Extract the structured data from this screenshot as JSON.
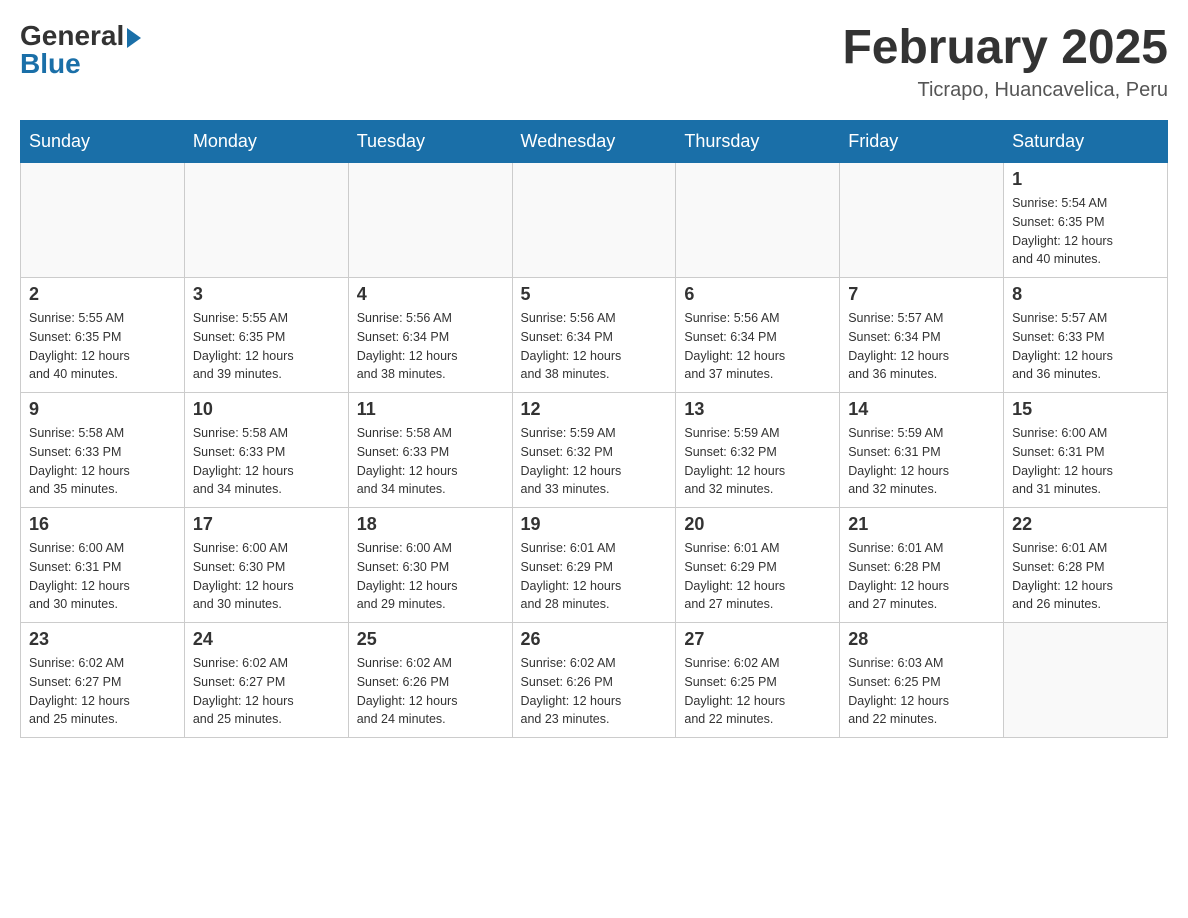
{
  "logo": {
    "general": "General",
    "blue": "Blue"
  },
  "header": {
    "title": "February 2025",
    "subtitle": "Ticrapo, Huancavelica, Peru"
  },
  "weekdays": [
    "Sunday",
    "Monday",
    "Tuesday",
    "Wednesday",
    "Thursday",
    "Friday",
    "Saturday"
  ],
  "weeks": [
    [
      {
        "day": "",
        "info": ""
      },
      {
        "day": "",
        "info": ""
      },
      {
        "day": "",
        "info": ""
      },
      {
        "day": "",
        "info": ""
      },
      {
        "day": "",
        "info": ""
      },
      {
        "day": "",
        "info": ""
      },
      {
        "day": "1",
        "info": "Sunrise: 5:54 AM\nSunset: 6:35 PM\nDaylight: 12 hours\nand 40 minutes."
      }
    ],
    [
      {
        "day": "2",
        "info": "Sunrise: 5:55 AM\nSunset: 6:35 PM\nDaylight: 12 hours\nand 40 minutes."
      },
      {
        "day": "3",
        "info": "Sunrise: 5:55 AM\nSunset: 6:35 PM\nDaylight: 12 hours\nand 39 minutes."
      },
      {
        "day": "4",
        "info": "Sunrise: 5:56 AM\nSunset: 6:34 PM\nDaylight: 12 hours\nand 38 minutes."
      },
      {
        "day": "5",
        "info": "Sunrise: 5:56 AM\nSunset: 6:34 PM\nDaylight: 12 hours\nand 38 minutes."
      },
      {
        "day": "6",
        "info": "Sunrise: 5:56 AM\nSunset: 6:34 PM\nDaylight: 12 hours\nand 37 minutes."
      },
      {
        "day": "7",
        "info": "Sunrise: 5:57 AM\nSunset: 6:34 PM\nDaylight: 12 hours\nand 36 minutes."
      },
      {
        "day": "8",
        "info": "Sunrise: 5:57 AM\nSunset: 6:33 PM\nDaylight: 12 hours\nand 36 minutes."
      }
    ],
    [
      {
        "day": "9",
        "info": "Sunrise: 5:58 AM\nSunset: 6:33 PM\nDaylight: 12 hours\nand 35 minutes."
      },
      {
        "day": "10",
        "info": "Sunrise: 5:58 AM\nSunset: 6:33 PM\nDaylight: 12 hours\nand 34 minutes."
      },
      {
        "day": "11",
        "info": "Sunrise: 5:58 AM\nSunset: 6:33 PM\nDaylight: 12 hours\nand 34 minutes."
      },
      {
        "day": "12",
        "info": "Sunrise: 5:59 AM\nSunset: 6:32 PM\nDaylight: 12 hours\nand 33 minutes."
      },
      {
        "day": "13",
        "info": "Sunrise: 5:59 AM\nSunset: 6:32 PM\nDaylight: 12 hours\nand 32 minutes."
      },
      {
        "day": "14",
        "info": "Sunrise: 5:59 AM\nSunset: 6:31 PM\nDaylight: 12 hours\nand 32 minutes."
      },
      {
        "day": "15",
        "info": "Sunrise: 6:00 AM\nSunset: 6:31 PM\nDaylight: 12 hours\nand 31 minutes."
      }
    ],
    [
      {
        "day": "16",
        "info": "Sunrise: 6:00 AM\nSunset: 6:31 PM\nDaylight: 12 hours\nand 30 minutes."
      },
      {
        "day": "17",
        "info": "Sunrise: 6:00 AM\nSunset: 6:30 PM\nDaylight: 12 hours\nand 30 minutes."
      },
      {
        "day": "18",
        "info": "Sunrise: 6:00 AM\nSunset: 6:30 PM\nDaylight: 12 hours\nand 29 minutes."
      },
      {
        "day": "19",
        "info": "Sunrise: 6:01 AM\nSunset: 6:29 PM\nDaylight: 12 hours\nand 28 minutes."
      },
      {
        "day": "20",
        "info": "Sunrise: 6:01 AM\nSunset: 6:29 PM\nDaylight: 12 hours\nand 27 minutes."
      },
      {
        "day": "21",
        "info": "Sunrise: 6:01 AM\nSunset: 6:28 PM\nDaylight: 12 hours\nand 27 minutes."
      },
      {
        "day": "22",
        "info": "Sunrise: 6:01 AM\nSunset: 6:28 PM\nDaylight: 12 hours\nand 26 minutes."
      }
    ],
    [
      {
        "day": "23",
        "info": "Sunrise: 6:02 AM\nSunset: 6:27 PM\nDaylight: 12 hours\nand 25 minutes."
      },
      {
        "day": "24",
        "info": "Sunrise: 6:02 AM\nSunset: 6:27 PM\nDaylight: 12 hours\nand 25 minutes."
      },
      {
        "day": "25",
        "info": "Sunrise: 6:02 AM\nSunset: 6:26 PM\nDaylight: 12 hours\nand 24 minutes."
      },
      {
        "day": "26",
        "info": "Sunrise: 6:02 AM\nSunset: 6:26 PM\nDaylight: 12 hours\nand 23 minutes."
      },
      {
        "day": "27",
        "info": "Sunrise: 6:02 AM\nSunset: 6:25 PM\nDaylight: 12 hours\nand 22 minutes."
      },
      {
        "day": "28",
        "info": "Sunrise: 6:03 AM\nSunset: 6:25 PM\nDaylight: 12 hours\nand 22 minutes."
      },
      {
        "day": "",
        "info": ""
      }
    ]
  ]
}
